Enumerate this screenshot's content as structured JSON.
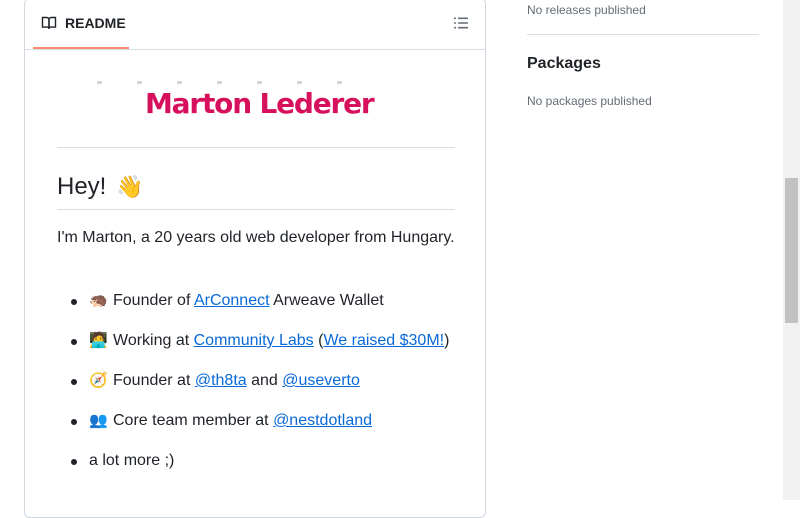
{
  "readme": {
    "tab_label": "README",
    "logo_text": "Marton Lederer",
    "heading": "Hey!",
    "heading_emoji": "👋",
    "intro": "I'm Marton, a 20 years old web developer from Hungary.",
    "items": [
      {
        "emoji": "🦔",
        "before": "Founder of ",
        "link1": "ArConnect",
        "middle": " Arweave Wallet",
        "link2": "",
        "after": ""
      },
      {
        "emoji": "🧑‍💻",
        "before": "Working at ",
        "link1": "Community Labs",
        "middle": " (",
        "link2": "We raised $30M!",
        "after": ")"
      },
      {
        "emoji": "🧭",
        "before": "Founder at ",
        "link1": "@th8ta",
        "middle": " and ",
        "link2": "@useverto",
        "after": ""
      },
      {
        "emoji": "👥",
        "before": "Core team member at ",
        "link1": "@nestdotland",
        "middle": "",
        "link2": "",
        "after": ""
      },
      {
        "emoji": "",
        "before": "a lot more ;)",
        "link1": "",
        "middle": "",
        "link2": "",
        "after": ""
      }
    ]
  },
  "sidebar": {
    "releases_text": "No releases published",
    "packages_title": "Packages",
    "packages_text": "No packages published"
  },
  "colors": {
    "accent": "#fd8c73",
    "link": "#0969da",
    "logo": "#d7105d"
  }
}
